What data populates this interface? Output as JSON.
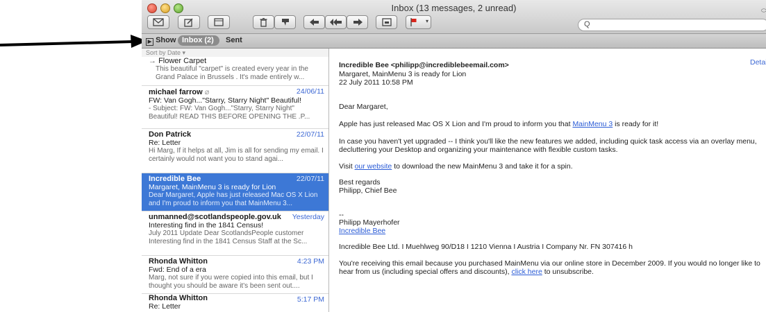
{
  "window": {
    "title": "Inbox (13 messages, 2 unread)"
  },
  "toolbar": {
    "buttons": [
      "envelope-icon",
      "compose-icon",
      "note-icon",
      "trash-icon",
      "junk-icon",
      "reply-icon",
      "reply-all-icon",
      "forward-icon",
      "archive-icon",
      "flag-icon"
    ],
    "search_glyph": "Q"
  },
  "favorites": {
    "show_label": "Show",
    "inbox_label": "Inbox (2)",
    "sent_label": "Sent"
  },
  "sort": {
    "label": "Sort by Date ▾"
  },
  "messages": [
    {
      "from": "Flower Carpet",
      "date": "",
      "subject": "",
      "preview": "This beautiful \"carpet\" is created every year in the Grand Palace in Brussels . It's made entirely w..."
    },
    {
      "from": "michael farrow",
      "date": "24/06/11",
      "subject": "FW: Van Gogh...\"Starry, Starry Night\" Beautiful!",
      "preview": "- Subject: FW: Van Gogh...\"Starry, Starry Night\" Beautiful! READ THIS BEFORE OPENING THE .P..."
    },
    {
      "from": "Don Patrick",
      "date": "22/07/11",
      "subject": "Re: Letter",
      "preview": "Hi Marg, If it helps at all, Jim is all for sending my email. I certainly would not want you to stand agai..."
    },
    {
      "from": "Incredible Bee",
      "date": "22/07/11",
      "subject": "Margaret, MainMenu 3 is ready for Lion",
      "preview": "Dear Margaret, Apple has just released Mac OS X Lion and I'm proud to inform you that MainMenu 3..."
    },
    {
      "from": "unmanned@scotlandspeople.gov.uk",
      "date": "Yesterday",
      "subject": "Interesting find in the 1841 Census!",
      "preview": "July 2011 Update Dear ScotlandsPeople customer Interesting find in the 1841 Census Staff at the Sc..."
    },
    {
      "from": "Rhonda Whitton",
      "date": "4:23 PM",
      "subject": "Fwd: End of a era",
      "preview": "Marg, not sure if you were copied into this email, but I thought you should be aware it's been sent out...."
    },
    {
      "from": "Rhonda Whitton",
      "date": "5:17 PM",
      "subject": "Re: Letter",
      "preview": ""
    }
  ],
  "email": {
    "sender": "Incredible Bee <philipp@incrediblebeemail.com>",
    "subject": "Margaret, MainMenu 3 is ready for Lion",
    "date": "22 July 2011 10:58 PM",
    "details_label": "Details",
    "greeting": "Dear Margaret,",
    "p1_before": "Apple has just released Mac OS X Lion and I'm proud to inform you that ",
    "p1_link": "MainMenu 3",
    "p1_after": " is ready for it!",
    "p2": "In case you haven't yet upgraded -- I think you'll like the new features we added, including quick task access via an overlay menu, decluttering your Desktop and organizing your maintenance with flexible custom tasks.",
    "p3_before": "Visit ",
    "p3_link": "our website",
    "p3_after": " to download the new MainMenu 3 and take it for a spin.",
    "regards": "Best regards",
    "signature": "Philipp, Chief Bee",
    "dashes": "--",
    "sig_name": "Philipp Mayerhofer",
    "sig_link": "Incredible Bee",
    "company": "Incredible Bee Ltd. I Muehlweg 90/D18 I 1210 Vienna I Austria I Company Nr. FN 307416 h",
    "footer_before": "You're receiving this email because you purchased MainMenu via our online store in December 2009. If you would no longer like to hear from us (including special offers and discounts), ",
    "footer_link": "click here",
    "footer_after": " to unsubscribe."
  }
}
